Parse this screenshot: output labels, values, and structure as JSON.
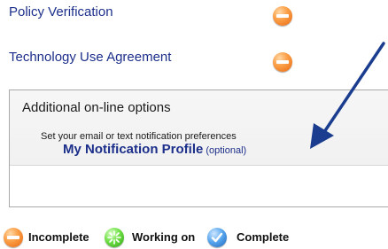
{
  "tasks": [
    {
      "label": "Policy Verification",
      "status": "incomplete"
    },
    {
      "label": "Technology Use Agreement",
      "status": "incomplete"
    }
  ],
  "options": {
    "title": "Additional on-line options",
    "description": "Set your email or text notification preferences",
    "profile_link": "My Notification Profile",
    "profile_note": "(optional)"
  },
  "legend": [
    {
      "label": "Incomplete",
      "icon": "orange-minus-icon"
    },
    {
      "label": "Working on",
      "icon": "green-spinner-icon"
    },
    {
      "label": "Complete",
      "icon": "blue-check-icon"
    }
  ],
  "colors": {
    "link": "#1c2f8a",
    "arrow": "#1b3d8f",
    "incomplete": "#f58a2a",
    "working": "#5cc93a",
    "complete": "#3a8ee0"
  }
}
